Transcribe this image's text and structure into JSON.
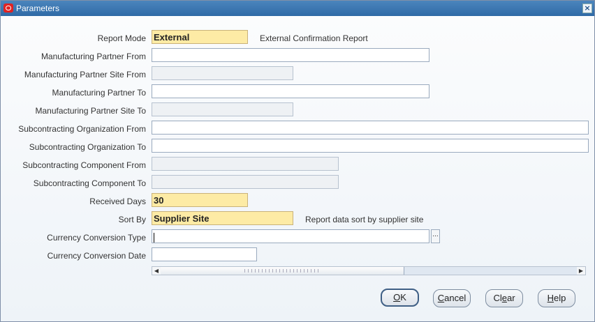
{
  "window": {
    "title": "Parameters"
  },
  "form": {
    "report_mode": {
      "label": "Report Mode",
      "value": "External",
      "hint": "External Confirmation Report"
    },
    "mfg_partner_from": {
      "label": "Manufacturing Partner From",
      "value": ""
    },
    "mfg_partner_site_from": {
      "label": "Manufacturing Partner Site From",
      "value": ""
    },
    "mfg_partner_to": {
      "label": "Manufacturing Partner To",
      "value": ""
    },
    "mfg_partner_site_to": {
      "label": "Manufacturing Partner Site To",
      "value": ""
    },
    "subcon_org_from": {
      "label": "Subcontracting Organization From",
      "value": ""
    },
    "subcon_org_to": {
      "label": "Subcontracting Organization To",
      "value": ""
    },
    "subcon_comp_from": {
      "label": "Subcontracting Component From",
      "value": ""
    },
    "subcon_comp_to": {
      "label": "Subcontracting Component To",
      "value": ""
    },
    "received_days": {
      "label": "Received Days",
      "value": "30"
    },
    "sort_by": {
      "label": "Sort By",
      "value": "Supplier Site",
      "hint": "Report data sort by supplier site"
    },
    "currency_conv_type": {
      "label": "Currency Conversion Type",
      "value": "",
      "lov": "..."
    },
    "currency_conv_date": {
      "label": "Currency Conversion Date",
      "value": ""
    }
  },
  "buttons": {
    "ok": {
      "mnemonic": "O",
      "rest": "K"
    },
    "cancel": {
      "mnemonic": "C",
      "rest": "ancel"
    },
    "clear": {
      "pre": "Cl",
      "mnemonic": "e",
      "rest": "ar"
    },
    "help": {
      "mnemonic": "H",
      "rest": "elp"
    }
  },
  "icons": {
    "app": "oracle-icon",
    "close": "close-icon",
    "lov": "ellipsis-icon"
  }
}
